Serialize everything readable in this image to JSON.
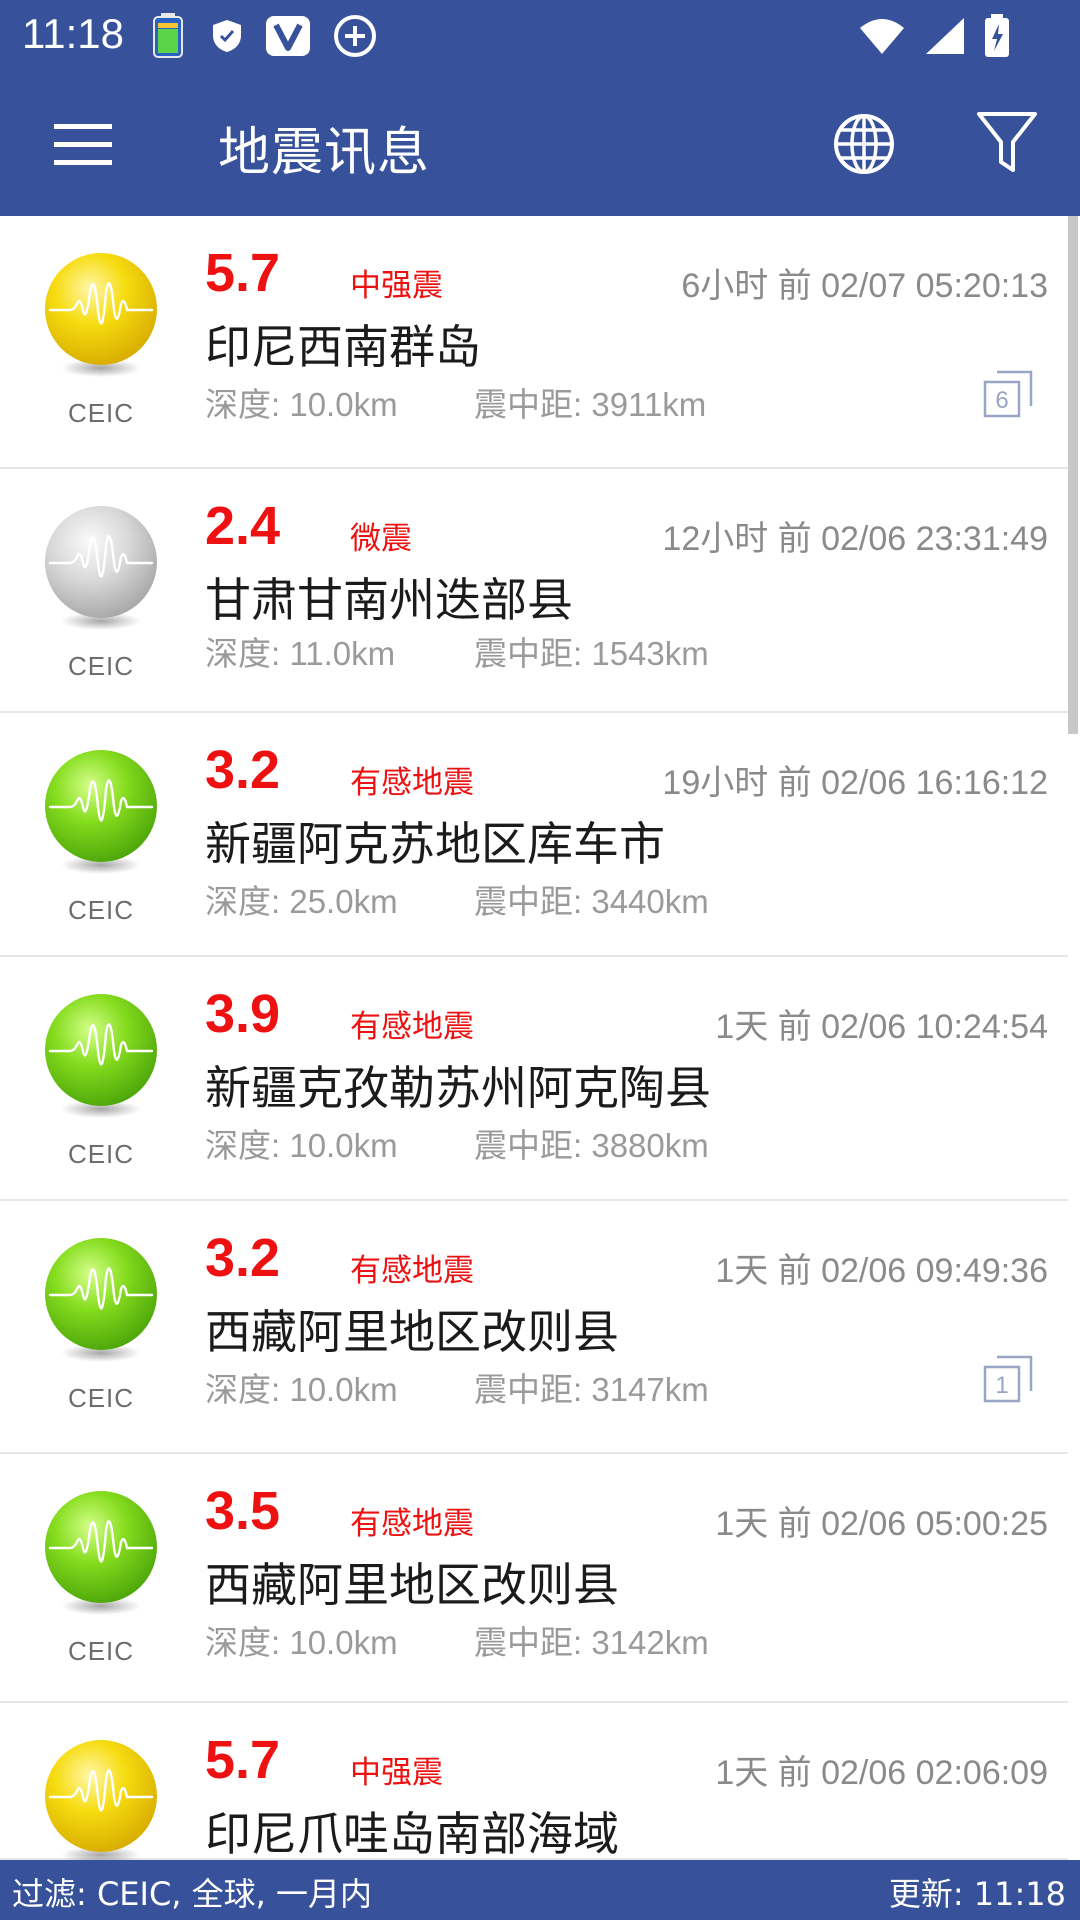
{
  "status_bar": {
    "time": "11:18",
    "icons": [
      "battery-app-icon",
      "shield-icon",
      "v-app-icon",
      "plus-circle-icon",
      "wifi-icon",
      "signal-icon",
      "battery-charging-icon"
    ]
  },
  "app_bar": {
    "title": "地震讯息",
    "icons": [
      "menu-icon",
      "globe-icon",
      "filter-icon"
    ]
  },
  "colors": {
    "primary": "#37529b",
    "magnitude_red": "#ee1111",
    "ball_yellow": "#f2d500",
    "ball_green": "#78d41a",
    "ball_gray": "#cfcfcf"
  },
  "quakes": [
    {
      "magnitude": "5.7",
      "level": "中强震",
      "time": "6小时 前 02/07 05:20:13",
      "place": "印尼西南群岛",
      "depth": "深度: 10.0km",
      "distance": "震中距: 3911km",
      "source": "CEIC",
      "ball_color": "yellow",
      "badge": "6"
    },
    {
      "magnitude": "2.4",
      "level": "微震",
      "time": "12小时 前 02/06 23:31:49",
      "place": "甘肃甘南州迭部县",
      "depth": "深度: 11.0km",
      "distance": "震中距: 1543km",
      "source": "CEIC",
      "ball_color": "gray",
      "badge": ""
    },
    {
      "magnitude": "3.2",
      "level": "有感地震",
      "time": "19小时 前 02/06 16:16:12",
      "place": "新疆阿克苏地区库车市",
      "depth": "深度: 25.0km",
      "distance": "震中距: 3440km",
      "source": "CEIC",
      "ball_color": "green",
      "badge": ""
    },
    {
      "magnitude": "3.9",
      "level": "有感地震",
      "time": "1天 前 02/06 10:24:54",
      "place": "新疆克孜勒苏州阿克陶县",
      "depth": "深度: 10.0km",
      "distance": "震中距: 3880km",
      "source": "CEIC",
      "ball_color": "green",
      "badge": ""
    },
    {
      "magnitude": "3.2",
      "level": "有感地震",
      "time": "1天 前 02/06 09:49:36",
      "place": "西藏阿里地区改则县",
      "depth": "深度: 10.0km",
      "distance": "震中距: 3147km",
      "source": "CEIC",
      "ball_color": "green",
      "badge": "1"
    },
    {
      "magnitude": "3.5",
      "level": "有感地震",
      "time": "1天 前 02/06 05:00:25",
      "place": "西藏阿里地区改则县",
      "depth": "深度: 10.0km",
      "distance": "震中距: 3142km",
      "source": "CEIC",
      "ball_color": "green",
      "badge": ""
    },
    {
      "magnitude": "5.7",
      "level": "中强震",
      "time": "1天 前 02/06 02:06:09",
      "place": "印尼爪哇岛南部海域",
      "depth": "",
      "distance": "",
      "source": "",
      "ball_color": "yellow",
      "badge": ""
    }
  ],
  "footer": {
    "filter": "过滤: CEIC, 全球, 一月内",
    "update": "更新: 11:18"
  }
}
